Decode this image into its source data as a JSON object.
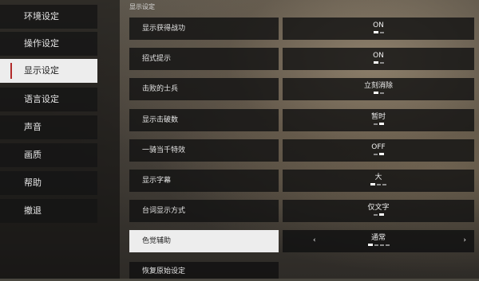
{
  "sidebar": {
    "items": [
      {
        "label": "环境设定",
        "active": false
      },
      {
        "label": "操作设定",
        "active": false
      },
      {
        "label": "显示设定",
        "active": true
      },
      {
        "label": "语言设定",
        "active": false
      },
      {
        "label": "声音",
        "active": false
      },
      {
        "label": "画质",
        "active": false
      },
      {
        "label": "帮助",
        "active": false
      },
      {
        "label": "撤退",
        "active": false
      }
    ]
  },
  "main": {
    "section_title": "显示设定",
    "rows": [
      {
        "label": "显示获得战功",
        "value": "ON",
        "option_count": 2,
        "selected_index": 0
      },
      {
        "label": "招式提示",
        "value": "ON",
        "option_count": 2,
        "selected_index": 0
      },
      {
        "label": "击败的士兵",
        "value": "立刻消除",
        "option_count": 2,
        "selected_index": 0
      },
      {
        "label": "显示击破数",
        "value": "暂时",
        "option_count": 2,
        "selected_index": 1
      },
      {
        "label": "一骑当千特效",
        "value": "OFF",
        "option_count": 2,
        "selected_index": 1
      },
      {
        "label": "显示字幕",
        "value": "大",
        "option_count": 3,
        "selected_index": 0
      },
      {
        "label": "台词显示方式",
        "value": "仅文字",
        "option_count": 2,
        "selected_index": 1
      },
      {
        "label": "色觉辅助",
        "value": "通常",
        "option_count": 4,
        "selected_index": 0,
        "active": true,
        "left_arrow": "‹",
        "right_arrow": "›"
      }
    ],
    "reset_label": "恢复原始设定"
  }
}
